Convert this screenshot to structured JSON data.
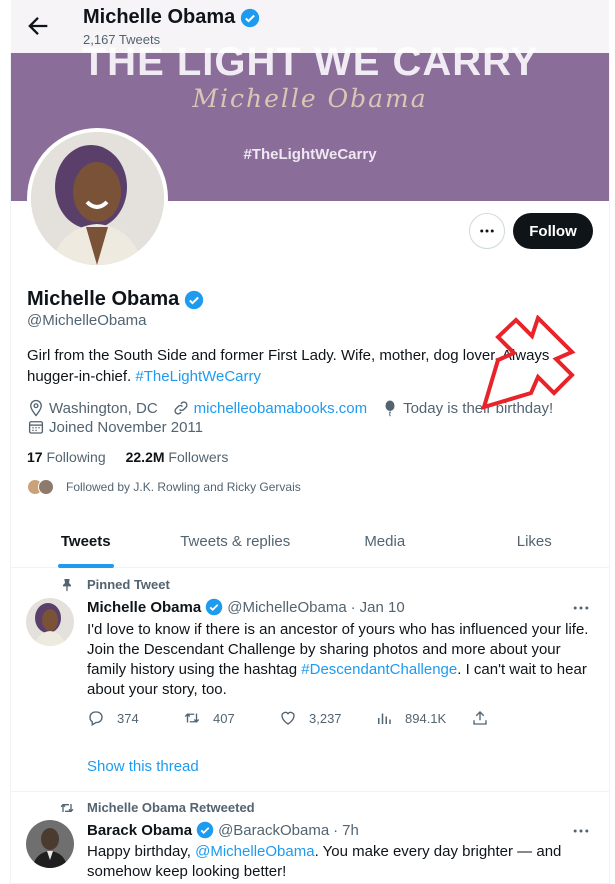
{
  "header": {
    "name": "Michelle Obama",
    "tweet_count": "2,167 Tweets"
  },
  "banner": {
    "title": "THE LIGHT WE CARRY",
    "signature": "Michelle Obama",
    "hashtag": "#TheLightWeCarry",
    "background_color": "#8a6e99"
  },
  "profile": {
    "name": "Michelle Obama",
    "handle": "@MichelleObama",
    "bio_text": "Girl from the South Side and former First Lady. Wife, mother, dog lover. Always hugger-in-chief.",
    "bio_link": "#TheLightWeCarry",
    "location": "Washington, DC",
    "website": "michelleobamabooks.com",
    "birthday": "Today is their birthday!",
    "joined": "Joined November 2011",
    "following_count": "17",
    "following_label": "Following",
    "followers_count": "22.2M",
    "followers_label": "Followers",
    "followed_by": "Followed by J.K. Rowling and Ricky Gervais",
    "follow_button": "Follow",
    "more_icon": "more-horizontal-icon"
  },
  "tabs": [
    {
      "label": "Tweets",
      "active": true
    },
    {
      "label": "Tweets & replies",
      "active": false
    },
    {
      "label": "Media",
      "active": false
    },
    {
      "label": "Likes",
      "active": false
    }
  ],
  "tweets": [
    {
      "context": "Pinned Tweet",
      "context_icon": "pin-icon",
      "name": "Michelle Obama",
      "handle": "@MichelleObama",
      "separator": "·",
      "time": "Jan 10",
      "text_before": "I'd love to know if there is an ancestor of yours who has influenced your life. Join the Descendant Challenge by sharing photos and more about your family history using the hashtag ",
      "text_link": "#DescendantChallenge",
      "text_after": ". I can't wait to hear about your story, too.",
      "replies": "374",
      "retweets": "407",
      "likes": "3,237",
      "views": "894.1K",
      "show_thread": "Show this thread"
    },
    {
      "context": "Michelle Obama Retweeted",
      "context_icon": "retweet-icon",
      "name": "Barack Obama",
      "handle": "@BarackObama",
      "separator": "·",
      "time": "7h",
      "text_before": "Happy birthday, ",
      "text_link": "@MichelleObama",
      "text_after": ". You make every day brighter — and somehow keep looking better!"
    }
  ],
  "colors": {
    "accent": "#1d9bf0",
    "text": "#0f1419",
    "muted": "#536471",
    "annotation": "#e8232a"
  }
}
